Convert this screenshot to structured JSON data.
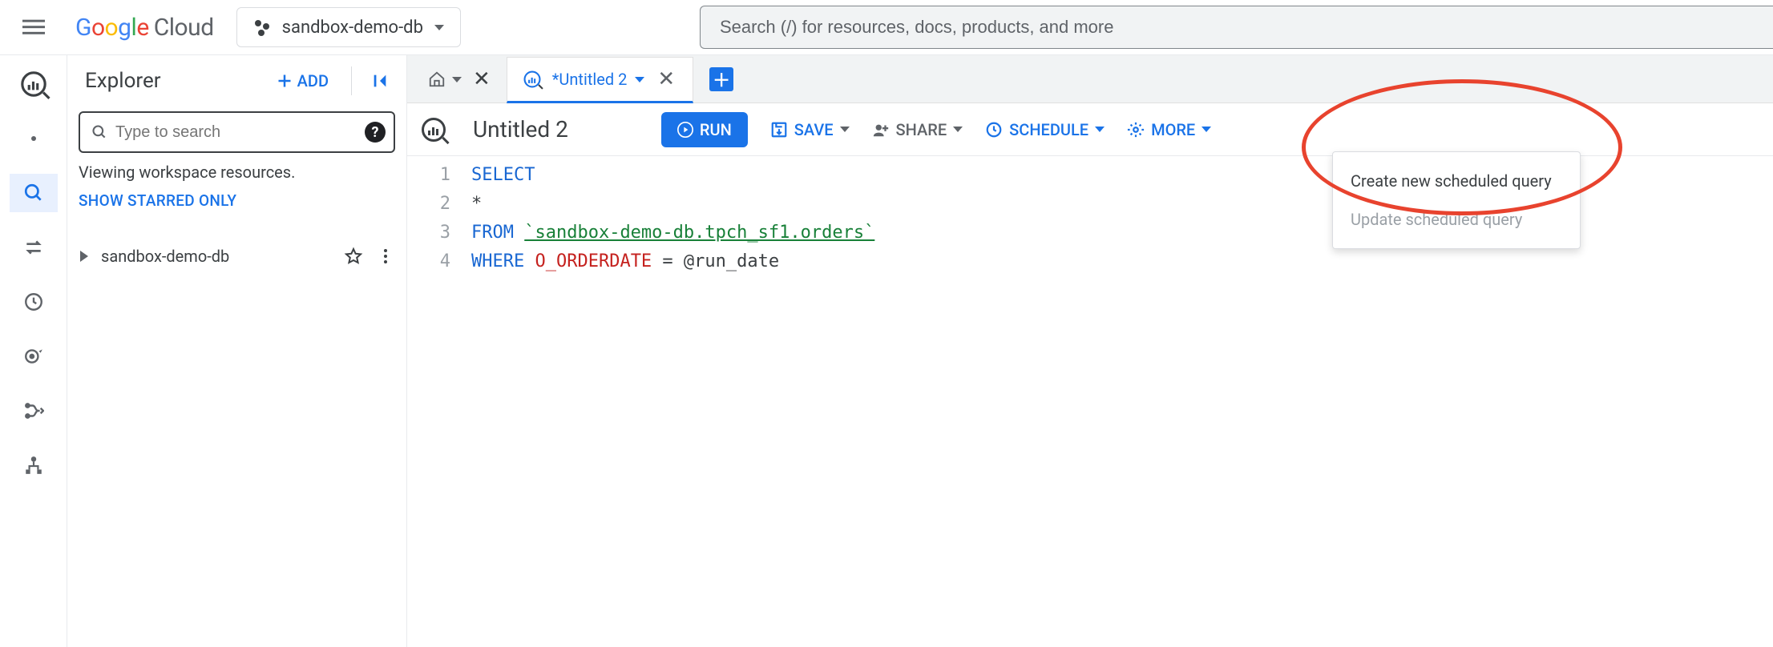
{
  "header": {
    "logo_product": "Cloud",
    "project_name": "sandbox-demo-db",
    "search_placeholder": "Search (/) for resources, docs, products, and more"
  },
  "explorer": {
    "title": "Explorer",
    "add_label": "ADD",
    "search_placeholder": "Type to search",
    "viewing_text": "Viewing workspace resources.",
    "starred_link": "SHOW STARRED ONLY",
    "project_node": "sandbox-demo-db"
  },
  "tabs": {
    "active_tab_label": "*Untitled 2"
  },
  "toolbar": {
    "doc_title": "Untitled 2",
    "run_label": "RUN",
    "save_label": "SAVE",
    "share_label": "SHARE",
    "schedule_label": "SCHEDULE",
    "more_label": "MORE"
  },
  "schedule_menu": {
    "create": "Create new scheduled query",
    "update": "Update scheduled query"
  },
  "editor": {
    "lines": [
      "1",
      "2",
      "3",
      "4"
    ],
    "kw_select": "SELECT",
    "star": "*",
    "kw_from": "FROM",
    "table": "`sandbox-demo-db.tpch_sf1.orders`",
    "kw_where": "WHERE",
    "col": "O_ORDERDATE",
    "rest": " = @run_date"
  }
}
